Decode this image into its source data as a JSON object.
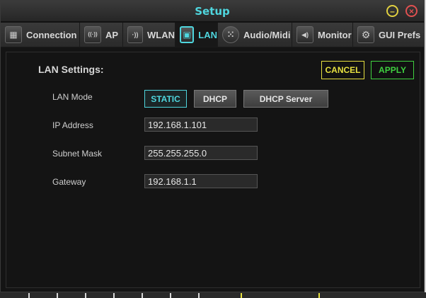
{
  "window": {
    "title": "Setup",
    "minimize_label": "–",
    "close_label": "×"
  },
  "tabs": [
    {
      "label": "Connection",
      "icon": "connection-icon",
      "glyph": "▦"
    },
    {
      "label": "AP",
      "icon": "antenna-icon",
      "glyph": "((·))"
    },
    {
      "label": "WLAN",
      "icon": "wifi-icon",
      "glyph": "·))"
    },
    {
      "label": "LAN",
      "icon": "ethernet-icon",
      "glyph": "▣"
    },
    {
      "label": "Audio/Midi",
      "icon": "midi-icon",
      "glyph": "⁙"
    },
    {
      "label": "Monitor",
      "icon": "speaker-icon",
      "glyph": "◀)"
    },
    {
      "label": "GUI Prefs",
      "icon": "gear-icon",
      "glyph": "⚙"
    }
  ],
  "lan": {
    "section_title": "LAN Settings:",
    "cancel_label": "CANCEL",
    "apply_label": "APPLY",
    "mode_label": "LAN Mode",
    "modes": [
      "STATIC",
      "DHCP",
      "DHCP Server"
    ],
    "selected_mode": "STATIC",
    "ip_label": "IP Address",
    "ip_value": "192.168.1.101",
    "subnet_label": "Subnet Mask",
    "subnet_value": "255.255.255.0",
    "gateway_label": "Gateway",
    "gateway_value": "192.168.1.1"
  },
  "colors": {
    "accent": "#4fd6de",
    "cancel": "#e6e040",
    "apply": "#3fd040"
  }
}
